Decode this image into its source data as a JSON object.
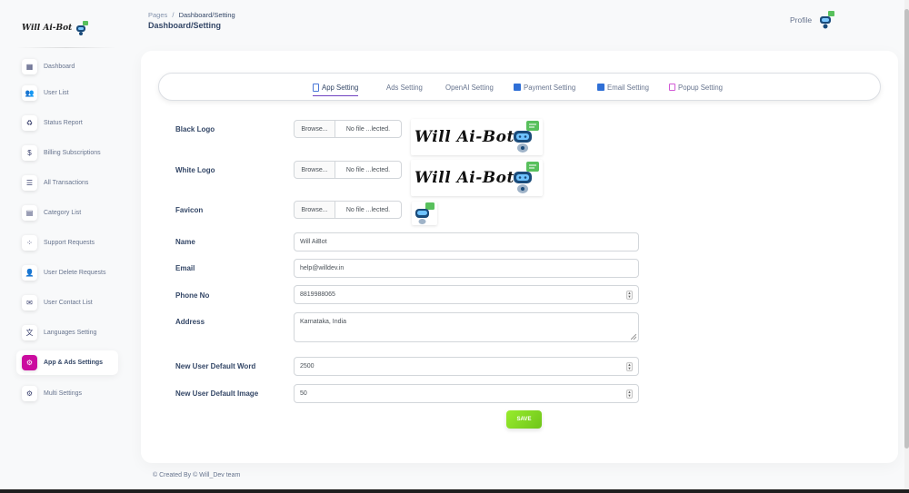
{
  "brand": {
    "name": "Will Ai-Bot"
  },
  "header": {
    "breadcrumb_root": "Pages",
    "breadcrumb_sep": "/",
    "breadcrumb_current": "Dashboard/Setting",
    "title": "Dashboard/Setting",
    "profile_label": "Profile"
  },
  "sidebar": {
    "items": [
      {
        "label": "Dashboard",
        "icon": "store-icon"
      },
      {
        "label": "User List",
        "icon": "users-icon"
      },
      {
        "label": "Status Report",
        "icon": "recycle-icon"
      },
      {
        "label": "Billing Subscriptions",
        "icon": "dollar-icon"
      },
      {
        "label": "All Transactions",
        "icon": "list-icon"
      },
      {
        "label": "Category List",
        "icon": "table-icon"
      },
      {
        "label": "Support Requests",
        "icon": "support-icon"
      },
      {
        "label": "User Delete Requests",
        "icon": "user-delete-icon"
      },
      {
        "label": "User Contact List",
        "icon": "envelope-icon"
      },
      {
        "label": "Languages Setting",
        "icon": "language-icon"
      },
      {
        "label": "App & Ads Settings",
        "icon": "gear-icon",
        "active": true
      },
      {
        "label": "Multi Settings",
        "icon": "gear-icon"
      }
    ]
  },
  "tabs": [
    {
      "label": "App Setting",
      "icon": "mobile-icon",
      "active": true
    },
    {
      "label": "Ads Setting",
      "icon": ""
    },
    {
      "label": "OpenAI Setting",
      "icon": ""
    },
    {
      "label": "Payment Setting",
      "icon": "credit-card-icon"
    },
    {
      "label": "Email Setting",
      "icon": "envelope-icon"
    },
    {
      "label": "Popup Setting",
      "icon": "popup-icon"
    }
  ],
  "form": {
    "black_logo": {
      "label": "Black Logo",
      "browse": "Browse...",
      "file": "No file ...lected."
    },
    "white_logo": {
      "label": "White Logo",
      "browse": "Browse...",
      "file": "No file ...lected."
    },
    "favicon": {
      "label": "Favicon",
      "browse": "Browse...",
      "file": "No file ...lected."
    },
    "logo_preview_text": "Will Ai-Bot",
    "name": {
      "label": "Name",
      "value": "Will AiBot"
    },
    "email": {
      "label": "Email",
      "value": "help@willdev.in"
    },
    "phone": {
      "label": "Phone No",
      "value": "8819988065"
    },
    "address": {
      "label": "Address",
      "value": "Karnataka, India"
    },
    "default_word": {
      "label": "New User Default Word",
      "value": "2500"
    },
    "default_image": {
      "label": "New User Default Image",
      "value": "50"
    },
    "save_label": "SAVE"
  },
  "footer": "© Created By © Will_Dev team",
  "colors": {
    "accent": "#cb0c9f",
    "save": "#82d616",
    "tab_underline": "#6f42c1",
    "bot_blue": "#1a4b7a",
    "bubble_green": "#58c05c"
  }
}
